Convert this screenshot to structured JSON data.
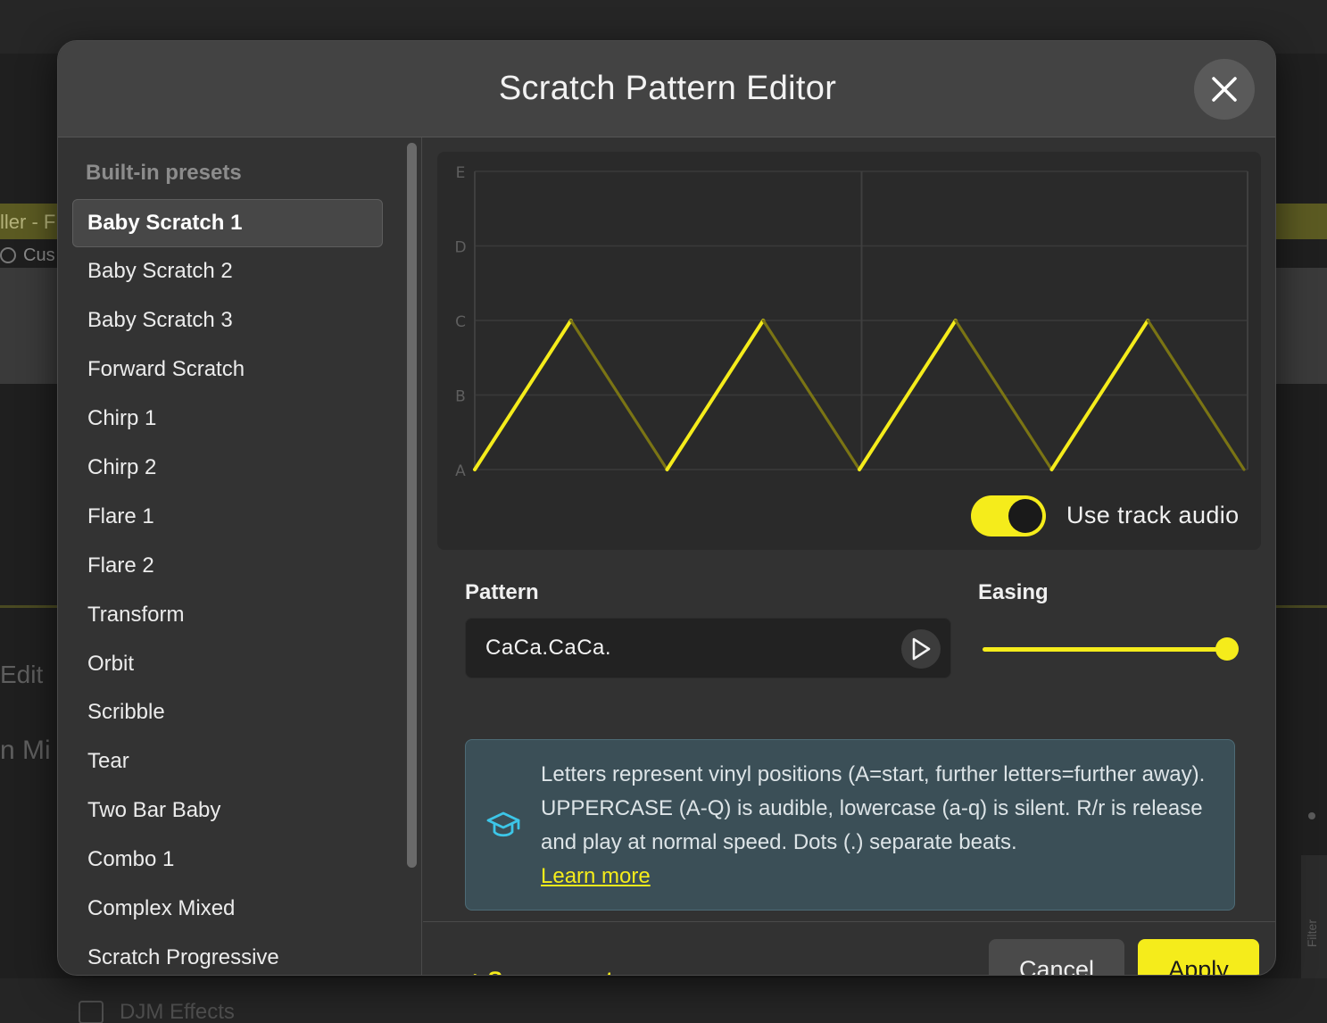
{
  "background": {
    "track_text": "ller - F",
    "cus_text": "Cus",
    "edit_text": "Edit",
    "mix_text": "n Mi",
    "djm_text": "DJM Effects",
    "filter_text": "Filter"
  },
  "modal": {
    "title": "Scratch Pattern Editor"
  },
  "sidebar": {
    "heading": "Built-in presets",
    "selected_index": 0,
    "presets": [
      "Baby Scratch 1",
      "Baby Scratch 2",
      "Baby Scratch 3",
      "Forward Scratch",
      "Chirp 1",
      "Chirp 2",
      "Flare 1",
      "Flare 2",
      "Transform",
      "Orbit",
      "Scribble",
      "Tear",
      "Two Bar Baby",
      "Combo 1",
      "Complex Mixed",
      "Scratch Progressive"
    ]
  },
  "graph": {
    "position_labels": [
      "E",
      "D",
      "C",
      "B",
      "A"
    ],
    "pattern_points": [
      "A",
      "C",
      "A",
      "C",
      "A",
      "C",
      "A",
      "C",
      "A"
    ],
    "segment_audible": [
      true,
      false,
      true,
      false,
      true,
      false,
      true,
      false
    ],
    "line_color": "#f5ec1b",
    "muted_color": "#7a7414"
  },
  "toggle": {
    "label": "Use track audio",
    "on": true
  },
  "pattern": {
    "label": "Pattern",
    "value": "CaCa.CaCa."
  },
  "easing": {
    "label": "Easing",
    "value": 1.0
  },
  "info": {
    "text": "Letters represent vinyl positions (A=start, further letters=further away). UPPERCASE (A-Q) is audible, lowercase (a-q) is silent. R/r is release and play at normal speed. Dots (.) separate beats.",
    "link": "Learn more"
  },
  "footer": {
    "save_preset": "+ Save preset",
    "cancel": "Cancel",
    "apply": "Apply"
  },
  "colors": {
    "accent": "#f5ec1b",
    "info_bg": "#3b4f57",
    "info_icon": "#3cc6e8"
  }
}
